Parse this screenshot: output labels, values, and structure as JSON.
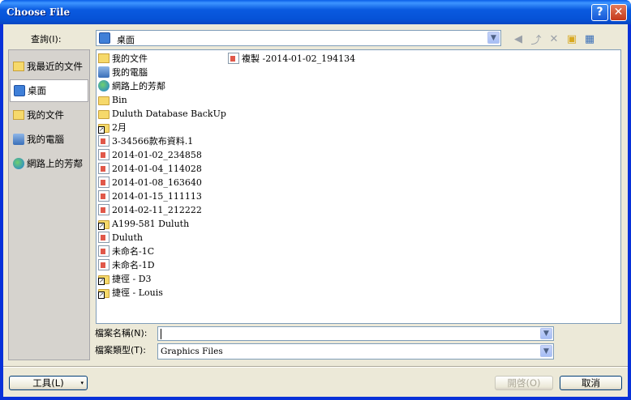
{
  "window": {
    "title": "Choose File",
    "help_glyph": "?",
    "close_glyph": "✕"
  },
  "lookin": {
    "label": "查詢(I):",
    "value": "桌面"
  },
  "places": [
    {
      "label": "我最近的文件",
      "icon": "recent-docs-icon"
    },
    {
      "label": "桌面",
      "icon": "desktop-icon"
    },
    {
      "label": "我的文件",
      "icon": "my-documents-icon"
    },
    {
      "label": "我的電腦",
      "icon": "my-computer-icon"
    },
    {
      "label": "網路上的芳鄰",
      "icon": "network-places-icon"
    }
  ],
  "files": [
    {
      "name": "我的文件",
      "kind": "mydocs"
    },
    {
      "name": "我的電腦",
      "kind": "pc"
    },
    {
      "name": "網路上的芳鄰",
      "kind": "net"
    },
    {
      "name": "Bin",
      "kind": "folder"
    },
    {
      "name": "Duluth Database BackUp",
      "kind": "folder"
    },
    {
      "name": "2月",
      "kind": "folder-shortcut"
    },
    {
      "name": "3-34566款布資料.1",
      "kind": "doc"
    },
    {
      "name": "2014-01-02_234858",
      "kind": "doc"
    },
    {
      "name": "2014-01-04_114028",
      "kind": "doc"
    },
    {
      "name": "2014-01-08_163640",
      "kind": "doc"
    },
    {
      "name": "2014-01-15_111113",
      "kind": "doc"
    },
    {
      "name": "2014-02-11_212222",
      "kind": "doc"
    },
    {
      "name": "A199-581 Duluth",
      "kind": "folder-shortcut"
    },
    {
      "name": "Duluth",
      "kind": "doc"
    },
    {
      "name": "未命名-1C",
      "kind": "doc"
    },
    {
      "name": "未命名-1D",
      "kind": "doc"
    },
    {
      "name": "捷徑 -  D3",
      "kind": "folder-shortcut"
    },
    {
      "name": "捷徑 -  Louis",
      "kind": "folder-shortcut"
    },
    {
      "name": "複製 -2014-01-02_194134",
      "kind": "doc"
    }
  ],
  "filename": {
    "label": "檔案名稱(N):",
    "value": ""
  },
  "filetype": {
    "label": "檔案類型(T):",
    "value": "Graphics Files"
  },
  "buttons": {
    "tools": "工具(L)",
    "open": "開啓(O)",
    "cancel": "取消"
  }
}
